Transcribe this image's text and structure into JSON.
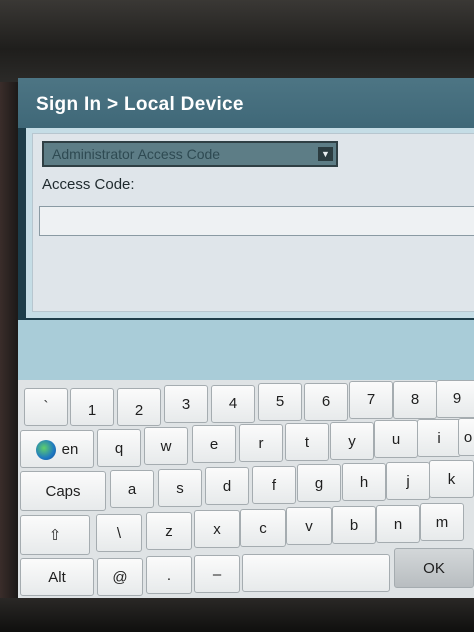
{
  "title": {
    "text": "Sign In > Local Device"
  },
  "form": {
    "method_selected": "Administrator Access Code",
    "access_code_label": "Access Code:",
    "access_code_value": ""
  },
  "keyboard": {
    "row1": [
      "`",
      "1",
      "2",
      "3",
      "4",
      "5",
      "6",
      "7",
      "8",
      "9"
    ],
    "row2": [
      "en",
      "q",
      "w",
      "e",
      "r",
      "t",
      "y",
      "u",
      "i",
      "o"
    ],
    "row3": [
      "Caps",
      "a",
      "s",
      "d",
      "f",
      "g",
      "h",
      "j",
      "k"
    ],
    "row4": [
      "⇧",
      "\\",
      "z",
      "x",
      "c",
      "v",
      "b",
      "n",
      "m"
    ],
    "row5": [
      "Alt",
      "@",
      ".",
      "–",
      "",
      "OK"
    ]
  }
}
